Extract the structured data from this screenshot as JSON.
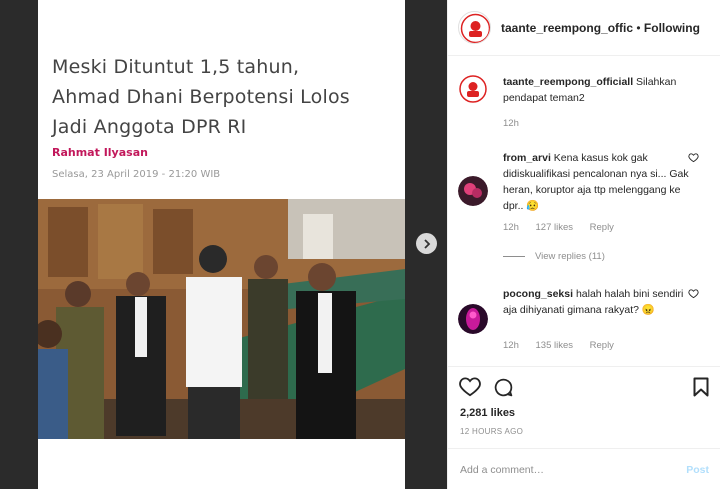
{
  "post": {
    "headline": "Meski Dituntut 1,5 tahun, Ahmad Dhani Berpotensi Lolos Jadi Anggota DPR RI",
    "author": "Rahmat Ilyasan",
    "date": "Selasa, 23 April 2019 - 21:20 WIB"
  },
  "header": {
    "username": "taante_reempong_offic",
    "separator": " • ",
    "follow_label": "Following"
  },
  "comments": [
    {
      "username": "taante_reempong_officiall",
      "text": "Silahkan pendapat teman2",
      "time": "12h",
      "likes": "",
      "reply": ""
    },
    {
      "username": "from_arvi",
      "text": "Kena kasus kok gak didiskualifikasi pencalonan nya si... Gak heran, koruptor aja ttp melenggang ke dpr..",
      "emoji": "😥",
      "time": "12h",
      "likes": "127 likes",
      "reply": "Reply"
    },
    {
      "username": "pocong_seksi",
      "text": "halah halah bini sendiri aja dihiyanati gimana rakyat?",
      "emoji": "😠",
      "time": "12h",
      "likes": "135 likes",
      "reply": "Reply"
    }
  ],
  "view_replies": "View replies (11)",
  "likes_count": "2,281 likes",
  "time_ago": "12 HOURS AGO",
  "add_comment": {
    "placeholder": "Add a comment…",
    "post_label": "Post"
  },
  "colors": {
    "author": "#c2185b",
    "post_button_disabled": "#b2dffc",
    "meta_gray": "#8e8e8e"
  }
}
